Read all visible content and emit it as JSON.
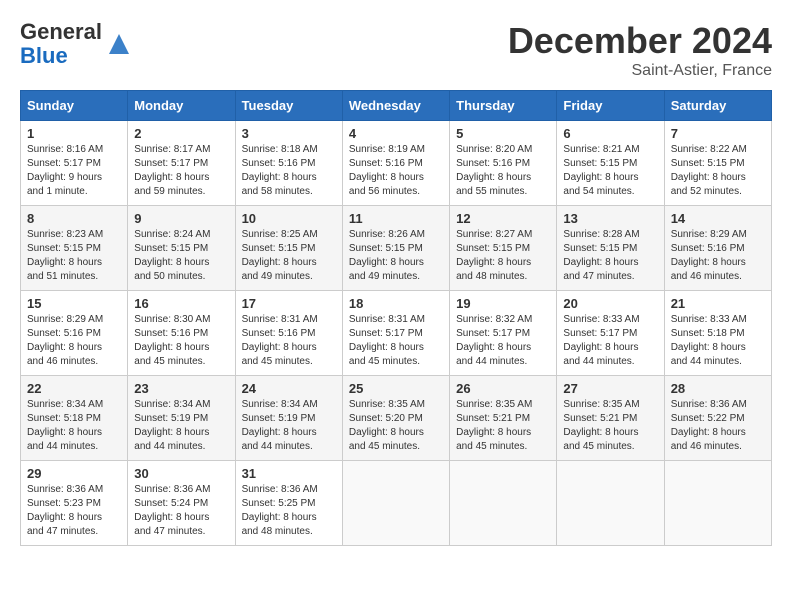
{
  "logo": {
    "general": "General",
    "blue": "Blue"
  },
  "title": "December 2024",
  "location": "Saint-Astier, France",
  "days_header": [
    "Sunday",
    "Monday",
    "Tuesday",
    "Wednesday",
    "Thursday",
    "Friday",
    "Saturday"
  ],
  "weeks": [
    [
      {
        "day": "1",
        "info": "Sunrise: 8:16 AM\nSunset: 5:17 PM\nDaylight: 9 hours\nand 1 minute."
      },
      {
        "day": "2",
        "info": "Sunrise: 8:17 AM\nSunset: 5:17 PM\nDaylight: 8 hours\nand 59 minutes."
      },
      {
        "day": "3",
        "info": "Sunrise: 8:18 AM\nSunset: 5:16 PM\nDaylight: 8 hours\nand 58 minutes."
      },
      {
        "day": "4",
        "info": "Sunrise: 8:19 AM\nSunset: 5:16 PM\nDaylight: 8 hours\nand 56 minutes."
      },
      {
        "day": "5",
        "info": "Sunrise: 8:20 AM\nSunset: 5:16 PM\nDaylight: 8 hours\nand 55 minutes."
      },
      {
        "day": "6",
        "info": "Sunrise: 8:21 AM\nSunset: 5:15 PM\nDaylight: 8 hours\nand 54 minutes."
      },
      {
        "day": "7",
        "info": "Sunrise: 8:22 AM\nSunset: 5:15 PM\nDaylight: 8 hours\nand 52 minutes."
      }
    ],
    [
      {
        "day": "8",
        "info": "Sunrise: 8:23 AM\nSunset: 5:15 PM\nDaylight: 8 hours\nand 51 minutes."
      },
      {
        "day": "9",
        "info": "Sunrise: 8:24 AM\nSunset: 5:15 PM\nDaylight: 8 hours\nand 50 minutes."
      },
      {
        "day": "10",
        "info": "Sunrise: 8:25 AM\nSunset: 5:15 PM\nDaylight: 8 hours\nand 49 minutes."
      },
      {
        "day": "11",
        "info": "Sunrise: 8:26 AM\nSunset: 5:15 PM\nDaylight: 8 hours\nand 49 minutes."
      },
      {
        "day": "12",
        "info": "Sunrise: 8:27 AM\nSunset: 5:15 PM\nDaylight: 8 hours\nand 48 minutes."
      },
      {
        "day": "13",
        "info": "Sunrise: 8:28 AM\nSunset: 5:15 PM\nDaylight: 8 hours\nand 47 minutes."
      },
      {
        "day": "14",
        "info": "Sunrise: 8:29 AM\nSunset: 5:16 PM\nDaylight: 8 hours\nand 46 minutes."
      }
    ],
    [
      {
        "day": "15",
        "info": "Sunrise: 8:29 AM\nSunset: 5:16 PM\nDaylight: 8 hours\nand 46 minutes."
      },
      {
        "day": "16",
        "info": "Sunrise: 8:30 AM\nSunset: 5:16 PM\nDaylight: 8 hours\nand 45 minutes."
      },
      {
        "day": "17",
        "info": "Sunrise: 8:31 AM\nSunset: 5:16 PM\nDaylight: 8 hours\nand 45 minutes."
      },
      {
        "day": "18",
        "info": "Sunrise: 8:31 AM\nSunset: 5:17 PM\nDaylight: 8 hours\nand 45 minutes."
      },
      {
        "day": "19",
        "info": "Sunrise: 8:32 AM\nSunset: 5:17 PM\nDaylight: 8 hours\nand 44 minutes."
      },
      {
        "day": "20",
        "info": "Sunrise: 8:33 AM\nSunset: 5:17 PM\nDaylight: 8 hours\nand 44 minutes."
      },
      {
        "day": "21",
        "info": "Sunrise: 8:33 AM\nSunset: 5:18 PM\nDaylight: 8 hours\nand 44 minutes."
      }
    ],
    [
      {
        "day": "22",
        "info": "Sunrise: 8:34 AM\nSunset: 5:18 PM\nDaylight: 8 hours\nand 44 minutes."
      },
      {
        "day": "23",
        "info": "Sunrise: 8:34 AM\nSunset: 5:19 PM\nDaylight: 8 hours\nand 44 minutes."
      },
      {
        "day": "24",
        "info": "Sunrise: 8:34 AM\nSunset: 5:19 PM\nDaylight: 8 hours\nand 44 minutes."
      },
      {
        "day": "25",
        "info": "Sunrise: 8:35 AM\nSunset: 5:20 PM\nDaylight: 8 hours\nand 45 minutes."
      },
      {
        "day": "26",
        "info": "Sunrise: 8:35 AM\nSunset: 5:21 PM\nDaylight: 8 hours\nand 45 minutes."
      },
      {
        "day": "27",
        "info": "Sunrise: 8:35 AM\nSunset: 5:21 PM\nDaylight: 8 hours\nand 45 minutes."
      },
      {
        "day": "28",
        "info": "Sunrise: 8:36 AM\nSunset: 5:22 PM\nDaylight: 8 hours\nand 46 minutes."
      }
    ],
    [
      {
        "day": "29",
        "info": "Sunrise: 8:36 AM\nSunset: 5:23 PM\nDaylight: 8 hours\nand 47 minutes."
      },
      {
        "day": "30",
        "info": "Sunrise: 8:36 AM\nSunset: 5:24 PM\nDaylight: 8 hours\nand 47 minutes."
      },
      {
        "day": "31",
        "info": "Sunrise: 8:36 AM\nSunset: 5:25 PM\nDaylight: 8 hours\nand 48 minutes."
      },
      {
        "day": "",
        "info": ""
      },
      {
        "day": "",
        "info": ""
      },
      {
        "day": "",
        "info": ""
      },
      {
        "day": "",
        "info": ""
      }
    ]
  ]
}
